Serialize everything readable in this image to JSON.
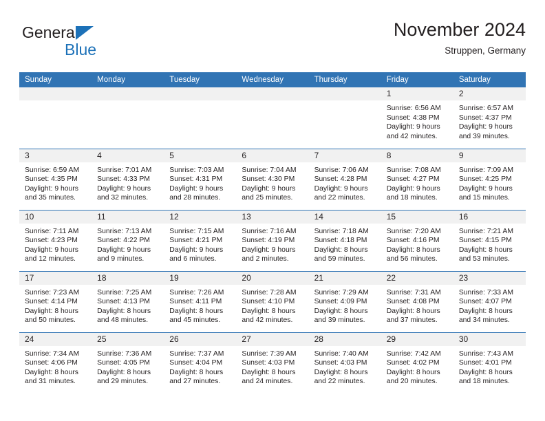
{
  "brand": {
    "name_top": "General",
    "name_bottom": "Blue",
    "accent_color": "#1c71b8"
  },
  "header": {
    "title": "November 2024",
    "location": "Struppen, Germany"
  },
  "theme": {
    "header_row_bg": "#3174b4",
    "daynum_bg": "#f1f1f1",
    "text_color": "#231f20"
  },
  "weekday_headers": [
    "Sunday",
    "Monday",
    "Tuesday",
    "Wednesday",
    "Thursday",
    "Friday",
    "Saturday"
  ],
  "weeks": [
    [
      {
        "day": "",
        "empty": true,
        "sunrise": "",
        "sunset": "",
        "daylight_line1": "",
        "daylight_line2": ""
      },
      {
        "day": "",
        "empty": true,
        "sunrise": "",
        "sunset": "",
        "daylight_line1": "",
        "daylight_line2": ""
      },
      {
        "day": "",
        "empty": true,
        "sunrise": "",
        "sunset": "",
        "daylight_line1": "",
        "daylight_line2": ""
      },
      {
        "day": "",
        "empty": true,
        "sunrise": "",
        "sunset": "",
        "daylight_line1": "",
        "daylight_line2": ""
      },
      {
        "day": "",
        "empty": true,
        "sunrise": "",
        "sunset": "",
        "daylight_line1": "",
        "daylight_line2": ""
      },
      {
        "day": "1",
        "empty": false,
        "sunrise": "Sunrise: 6:56 AM",
        "sunset": "Sunset: 4:38 PM",
        "daylight_line1": "Daylight: 9 hours",
        "daylight_line2": "and 42 minutes."
      },
      {
        "day": "2",
        "empty": false,
        "sunrise": "Sunrise: 6:57 AM",
        "sunset": "Sunset: 4:37 PM",
        "daylight_line1": "Daylight: 9 hours",
        "daylight_line2": "and 39 minutes."
      }
    ],
    [
      {
        "day": "3",
        "empty": false,
        "sunrise": "Sunrise: 6:59 AM",
        "sunset": "Sunset: 4:35 PM",
        "daylight_line1": "Daylight: 9 hours",
        "daylight_line2": "and 35 minutes."
      },
      {
        "day": "4",
        "empty": false,
        "sunrise": "Sunrise: 7:01 AM",
        "sunset": "Sunset: 4:33 PM",
        "daylight_line1": "Daylight: 9 hours",
        "daylight_line2": "and 32 minutes."
      },
      {
        "day": "5",
        "empty": false,
        "sunrise": "Sunrise: 7:03 AM",
        "sunset": "Sunset: 4:31 PM",
        "daylight_line1": "Daylight: 9 hours",
        "daylight_line2": "and 28 minutes."
      },
      {
        "day": "6",
        "empty": false,
        "sunrise": "Sunrise: 7:04 AM",
        "sunset": "Sunset: 4:30 PM",
        "daylight_line1": "Daylight: 9 hours",
        "daylight_line2": "and 25 minutes."
      },
      {
        "day": "7",
        "empty": false,
        "sunrise": "Sunrise: 7:06 AM",
        "sunset": "Sunset: 4:28 PM",
        "daylight_line1": "Daylight: 9 hours",
        "daylight_line2": "and 22 minutes."
      },
      {
        "day": "8",
        "empty": false,
        "sunrise": "Sunrise: 7:08 AM",
        "sunset": "Sunset: 4:27 PM",
        "daylight_line1": "Daylight: 9 hours",
        "daylight_line2": "and 18 minutes."
      },
      {
        "day": "9",
        "empty": false,
        "sunrise": "Sunrise: 7:09 AM",
        "sunset": "Sunset: 4:25 PM",
        "daylight_line1": "Daylight: 9 hours",
        "daylight_line2": "and 15 minutes."
      }
    ],
    [
      {
        "day": "10",
        "empty": false,
        "sunrise": "Sunrise: 7:11 AM",
        "sunset": "Sunset: 4:23 PM",
        "daylight_line1": "Daylight: 9 hours",
        "daylight_line2": "and 12 minutes."
      },
      {
        "day": "11",
        "empty": false,
        "sunrise": "Sunrise: 7:13 AM",
        "sunset": "Sunset: 4:22 PM",
        "daylight_line1": "Daylight: 9 hours",
        "daylight_line2": "and 9 minutes."
      },
      {
        "day": "12",
        "empty": false,
        "sunrise": "Sunrise: 7:15 AM",
        "sunset": "Sunset: 4:21 PM",
        "daylight_line1": "Daylight: 9 hours",
        "daylight_line2": "and 6 minutes."
      },
      {
        "day": "13",
        "empty": false,
        "sunrise": "Sunrise: 7:16 AM",
        "sunset": "Sunset: 4:19 PM",
        "daylight_line1": "Daylight: 9 hours",
        "daylight_line2": "and 2 minutes."
      },
      {
        "day": "14",
        "empty": false,
        "sunrise": "Sunrise: 7:18 AM",
        "sunset": "Sunset: 4:18 PM",
        "daylight_line1": "Daylight: 8 hours",
        "daylight_line2": "and 59 minutes."
      },
      {
        "day": "15",
        "empty": false,
        "sunrise": "Sunrise: 7:20 AM",
        "sunset": "Sunset: 4:16 PM",
        "daylight_line1": "Daylight: 8 hours",
        "daylight_line2": "and 56 minutes."
      },
      {
        "day": "16",
        "empty": false,
        "sunrise": "Sunrise: 7:21 AM",
        "sunset": "Sunset: 4:15 PM",
        "daylight_line1": "Daylight: 8 hours",
        "daylight_line2": "and 53 minutes."
      }
    ],
    [
      {
        "day": "17",
        "empty": false,
        "sunrise": "Sunrise: 7:23 AM",
        "sunset": "Sunset: 4:14 PM",
        "daylight_line1": "Daylight: 8 hours",
        "daylight_line2": "and 50 minutes."
      },
      {
        "day": "18",
        "empty": false,
        "sunrise": "Sunrise: 7:25 AM",
        "sunset": "Sunset: 4:13 PM",
        "daylight_line1": "Daylight: 8 hours",
        "daylight_line2": "and 48 minutes."
      },
      {
        "day": "19",
        "empty": false,
        "sunrise": "Sunrise: 7:26 AM",
        "sunset": "Sunset: 4:11 PM",
        "daylight_line1": "Daylight: 8 hours",
        "daylight_line2": "and 45 minutes."
      },
      {
        "day": "20",
        "empty": false,
        "sunrise": "Sunrise: 7:28 AM",
        "sunset": "Sunset: 4:10 PM",
        "daylight_line1": "Daylight: 8 hours",
        "daylight_line2": "and 42 minutes."
      },
      {
        "day": "21",
        "empty": false,
        "sunrise": "Sunrise: 7:29 AM",
        "sunset": "Sunset: 4:09 PM",
        "daylight_line1": "Daylight: 8 hours",
        "daylight_line2": "and 39 minutes."
      },
      {
        "day": "22",
        "empty": false,
        "sunrise": "Sunrise: 7:31 AM",
        "sunset": "Sunset: 4:08 PM",
        "daylight_line1": "Daylight: 8 hours",
        "daylight_line2": "and 37 minutes."
      },
      {
        "day": "23",
        "empty": false,
        "sunrise": "Sunrise: 7:33 AM",
        "sunset": "Sunset: 4:07 PM",
        "daylight_line1": "Daylight: 8 hours",
        "daylight_line2": "and 34 minutes."
      }
    ],
    [
      {
        "day": "24",
        "empty": false,
        "sunrise": "Sunrise: 7:34 AM",
        "sunset": "Sunset: 4:06 PM",
        "daylight_line1": "Daylight: 8 hours",
        "daylight_line2": "and 31 minutes."
      },
      {
        "day": "25",
        "empty": false,
        "sunrise": "Sunrise: 7:36 AM",
        "sunset": "Sunset: 4:05 PM",
        "daylight_line1": "Daylight: 8 hours",
        "daylight_line2": "and 29 minutes."
      },
      {
        "day": "26",
        "empty": false,
        "sunrise": "Sunrise: 7:37 AM",
        "sunset": "Sunset: 4:04 PM",
        "daylight_line1": "Daylight: 8 hours",
        "daylight_line2": "and 27 minutes."
      },
      {
        "day": "27",
        "empty": false,
        "sunrise": "Sunrise: 7:39 AM",
        "sunset": "Sunset: 4:03 PM",
        "daylight_line1": "Daylight: 8 hours",
        "daylight_line2": "and 24 minutes."
      },
      {
        "day": "28",
        "empty": false,
        "sunrise": "Sunrise: 7:40 AM",
        "sunset": "Sunset: 4:03 PM",
        "daylight_line1": "Daylight: 8 hours",
        "daylight_line2": "and 22 minutes."
      },
      {
        "day": "29",
        "empty": false,
        "sunrise": "Sunrise: 7:42 AM",
        "sunset": "Sunset: 4:02 PM",
        "daylight_line1": "Daylight: 8 hours",
        "daylight_line2": "and 20 minutes."
      },
      {
        "day": "30",
        "empty": false,
        "sunrise": "Sunrise: 7:43 AM",
        "sunset": "Sunset: 4:01 PM",
        "daylight_line1": "Daylight: 8 hours",
        "daylight_line2": "and 18 minutes."
      }
    ]
  ]
}
